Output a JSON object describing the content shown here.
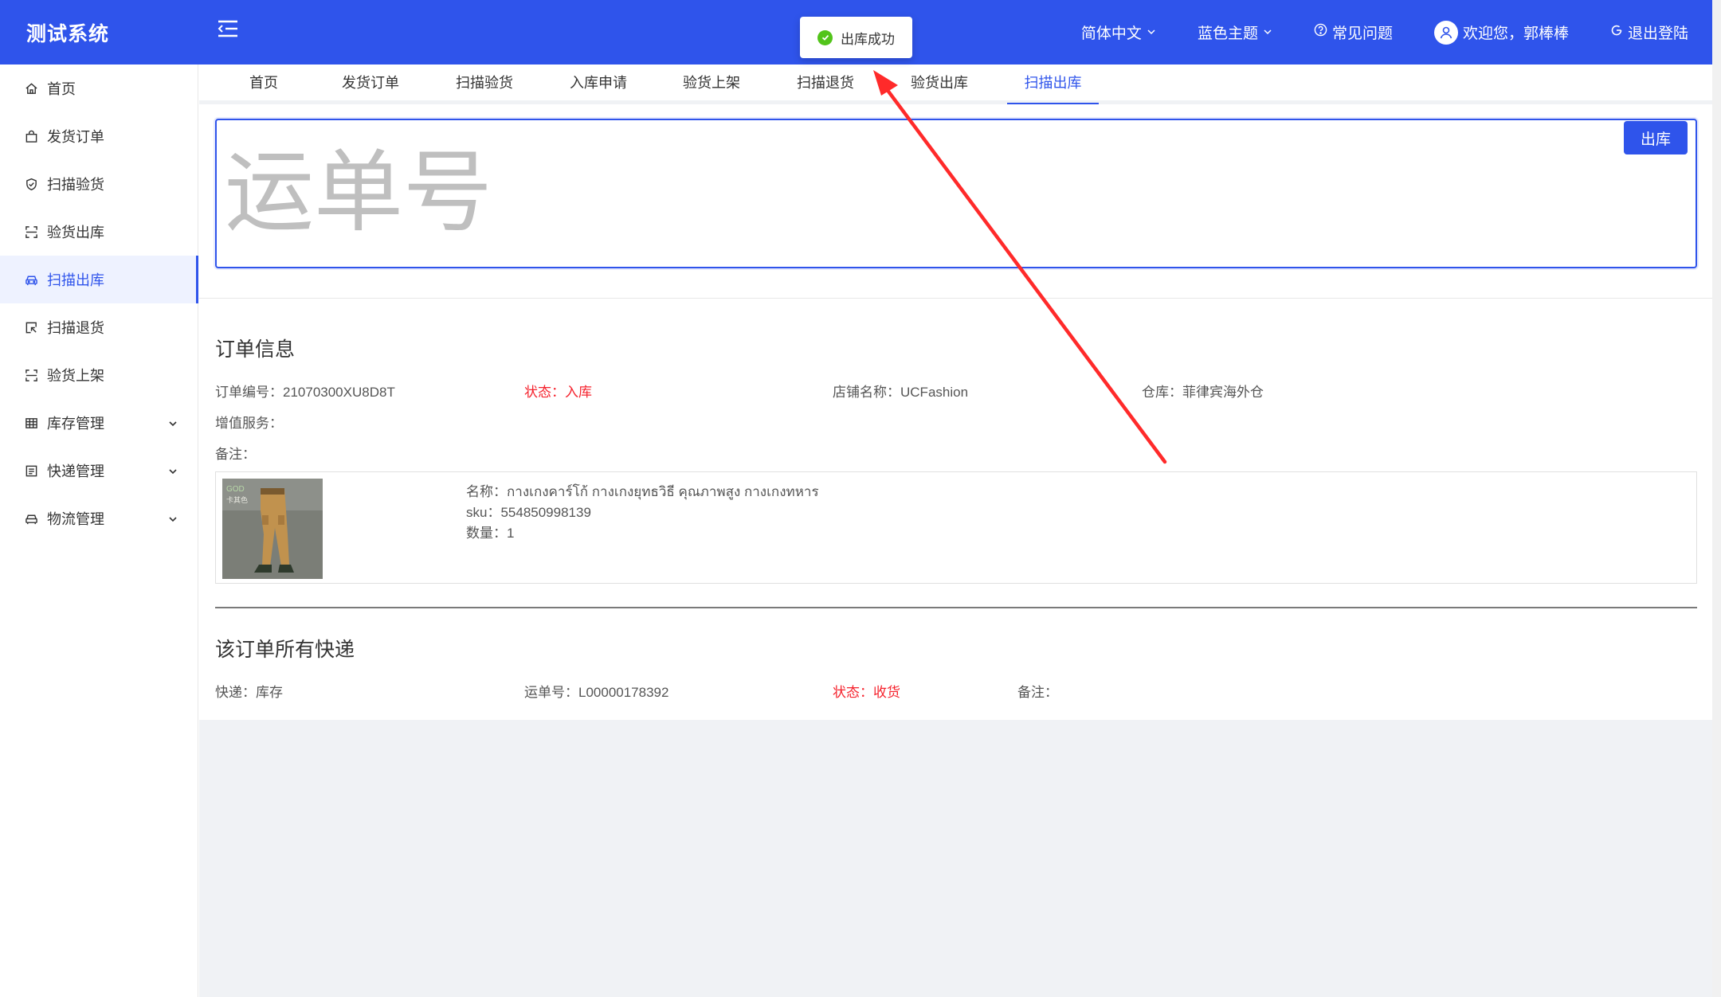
{
  "header": {
    "logo": "测试系统",
    "language": "简体中文",
    "theme": "蓝色主题",
    "faq": "常见问题",
    "welcome": "欢迎您，郭棒棒",
    "logout": "退出登陆"
  },
  "toast": {
    "message": "出库成功"
  },
  "sidebar": {
    "items": [
      {
        "label": "首页"
      },
      {
        "label": "发货订单"
      },
      {
        "label": "扫描验货"
      },
      {
        "label": "验货出库"
      },
      {
        "label": "扫描出库"
      },
      {
        "label": "扫描退货"
      },
      {
        "label": "验货上架"
      },
      {
        "label": "库存管理"
      },
      {
        "label": "快递管理"
      },
      {
        "label": "物流管理"
      }
    ]
  },
  "tabs": [
    {
      "label": "首页"
    },
    {
      "label": "发货订单"
    },
    {
      "label": "扫描验货"
    },
    {
      "label": "入库申请"
    },
    {
      "label": "验货上架"
    },
    {
      "label": "扫描退货"
    },
    {
      "label": "验货出库"
    },
    {
      "label": "扫描出库"
    }
  ],
  "scan": {
    "placeholder": "运单号",
    "value": "",
    "button": "出库"
  },
  "order": {
    "title": "订单信息",
    "order_no": "订单编号：21070300XU8D8T",
    "status": "状态：入库",
    "shop": "店铺名称：UCFashion",
    "warehouse": "仓库：菲律宾海外仓",
    "value_added": "增值服务：",
    "remark": "备注：",
    "product": {
      "name": "名称：กางเกงคาร์โก้ กางเกงยุทธวิธี คุณภาพสูง กางเกงทหาร",
      "sku": "sku：554850998139",
      "qty": "数量：1"
    }
  },
  "express": {
    "title": "该订单所有快递",
    "courier": "快递：库存",
    "waybill": "运单号：L00000178392",
    "status": "状态：收货",
    "remark": "备注："
  },
  "colors": {
    "primary": "#2f54eb",
    "danger": "#f5222d",
    "success": "#52c41a",
    "annotation": "#ff2a2a"
  }
}
